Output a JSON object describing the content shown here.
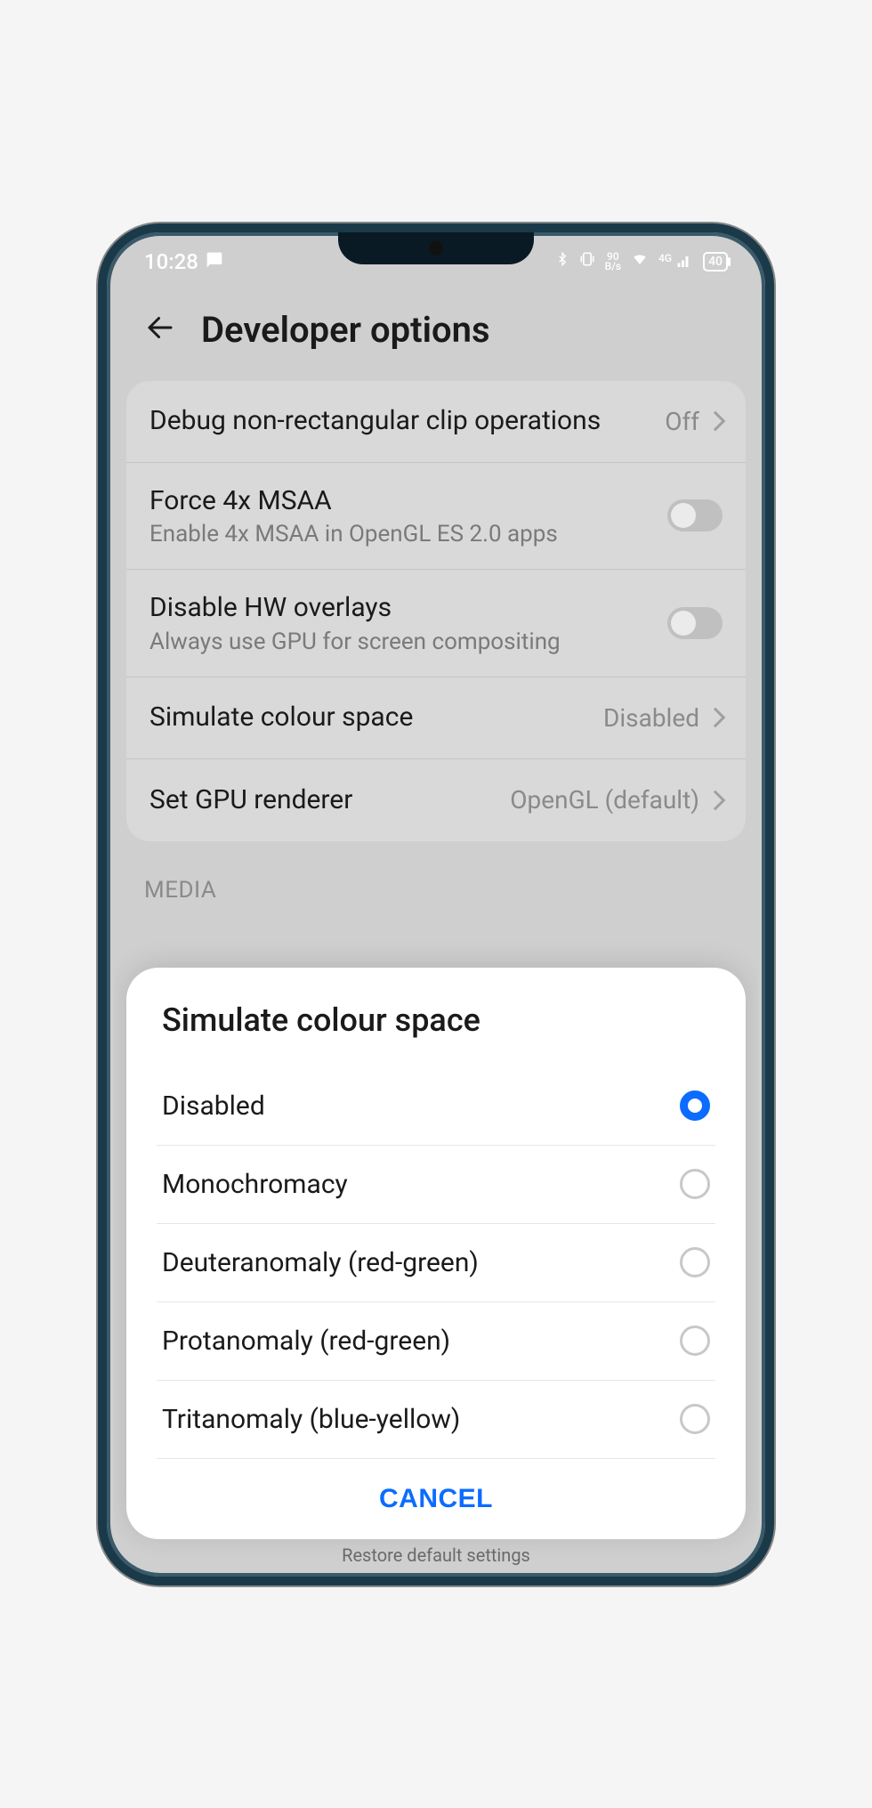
{
  "statusbar": {
    "time": "10:28",
    "net_rate_top": "90",
    "net_rate_bottom": "B/s",
    "net_label": "4G",
    "battery": "40"
  },
  "header": {
    "title": "Developer options"
  },
  "settings": {
    "items": [
      {
        "label": "Debug non-rectangular clip operations",
        "sub": "",
        "value": "Off",
        "type": "nav"
      },
      {
        "label": "Force 4x MSAA",
        "sub": "Enable 4x MSAA in OpenGL ES 2.0 apps",
        "value": "",
        "type": "toggle"
      },
      {
        "label": "Disable HW overlays",
        "sub": "Always use GPU for screen compositing",
        "value": "",
        "type": "toggle"
      },
      {
        "label": "Simulate colour space",
        "sub": "",
        "value": "Disabled",
        "type": "nav"
      },
      {
        "label": "Set GPU renderer",
        "sub": "",
        "value": "OpenGL (default)",
        "type": "nav"
      }
    ]
  },
  "section": {
    "media": "MEDIA"
  },
  "dialog": {
    "title": "Simulate colour space",
    "options": [
      {
        "label": "Disabled",
        "selected": true
      },
      {
        "label": "Monochromacy",
        "selected": false
      },
      {
        "label": "Deuteranomaly (red-green)",
        "selected": false
      },
      {
        "label": "Protanomaly (red-green)",
        "selected": false
      },
      {
        "label": "Tritanomaly (blue-yellow)",
        "selected": false
      }
    ],
    "cancel": "CANCEL"
  },
  "footer": {
    "restore": "Restore default settings"
  }
}
